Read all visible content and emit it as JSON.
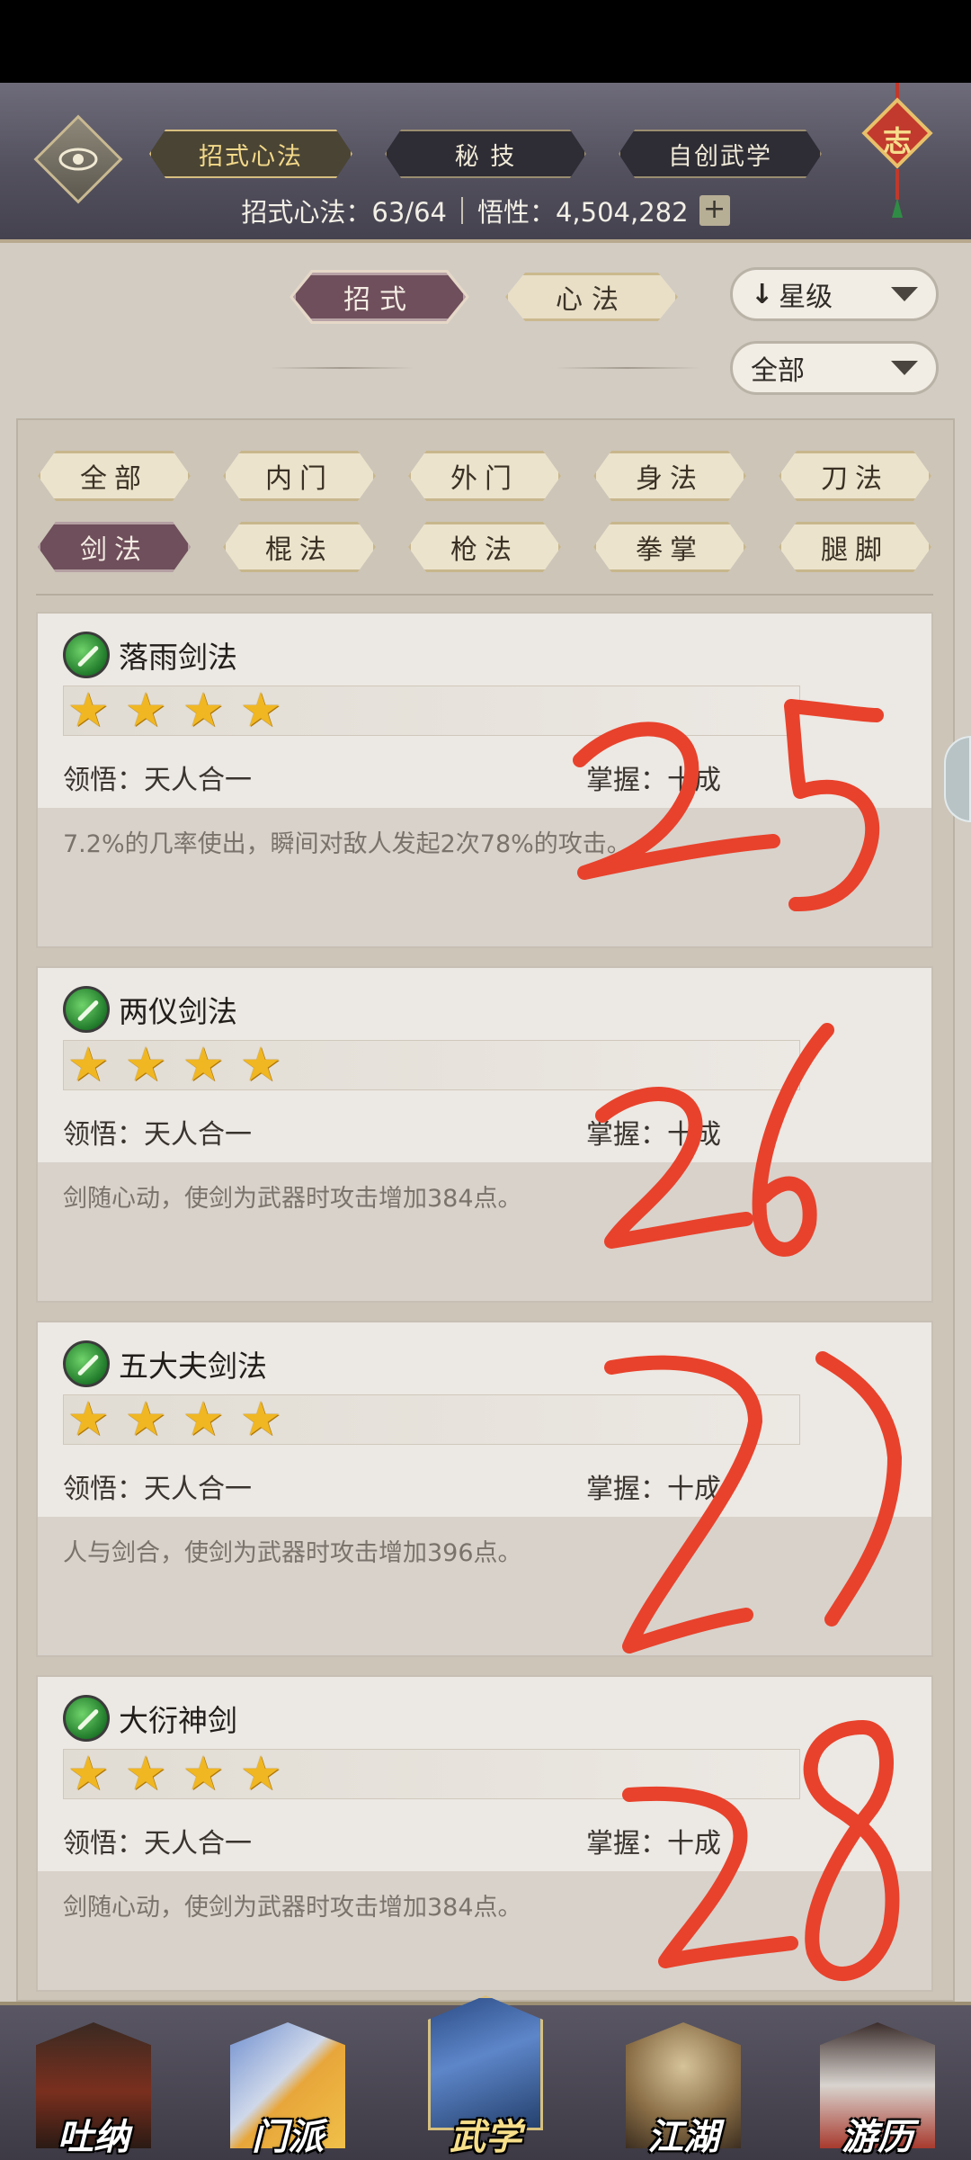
{
  "header": {
    "tabs": [
      {
        "label": "招式心法",
        "active": true
      },
      {
        "label": "秘 技",
        "active": false
      },
      {
        "label": "自创武学",
        "active": false
      }
    ],
    "stats": {
      "collection_label": "招式心法：63/64",
      "insight_label": "悟性：4,504,282",
      "plus_symbol": "+"
    },
    "charm_char": "志"
  },
  "subtabs": [
    {
      "label": "招式",
      "active": true
    },
    {
      "label": "心法",
      "active": false
    }
  ],
  "sort_dropdown": {
    "label": "星级",
    "arrow": "↓"
  },
  "filter_dropdown": {
    "label": "全部"
  },
  "categories": [
    {
      "label": "全部",
      "active": false
    },
    {
      "label": "内门",
      "active": false
    },
    {
      "label": "外门",
      "active": false
    },
    {
      "label": "身法",
      "active": false
    },
    {
      "label": "刀法",
      "active": false
    },
    {
      "label": "剑法",
      "active": true
    },
    {
      "label": "棍法",
      "active": false
    },
    {
      "label": "枪法",
      "active": false
    },
    {
      "label": "拳掌",
      "active": false
    },
    {
      "label": "腿脚",
      "active": false
    }
  ],
  "skills": [
    {
      "name": "落雨剑法",
      "stars": 4,
      "comprehension": "领悟：天人合一",
      "mastery": "掌握：十成",
      "description": "7.2%的几率使出，瞬间对敌人发起2次78%的攻击。"
    },
    {
      "name": "两仪剑法",
      "stars": 4,
      "comprehension": "领悟：天人合一",
      "mastery": "掌握：十成",
      "description": "剑随心动，使剑为武器时攻击增加384点。"
    },
    {
      "name": "五大夫剑法",
      "stars": 4,
      "comprehension": "领悟：天人合一",
      "mastery": "掌握：十成",
      "description": "人与剑合，使剑为武器时攻击增加396点。"
    },
    {
      "name": "大衍神剑",
      "stars": 4,
      "comprehension": "领悟：天人合一",
      "mastery": "掌握：十成",
      "description": "剑随心动，使剑为武器时攻击增加384点。"
    }
  ],
  "star_glyph": "★",
  "bottom_nav": [
    {
      "label": "吐纳",
      "active": false
    },
    {
      "label": "门派",
      "active": false
    },
    {
      "label": "武学",
      "active": true
    },
    {
      "label": "江湖",
      "active": false
    },
    {
      "label": "游历",
      "active": false
    }
  ],
  "annotations": [
    "25",
    "26",
    "27",
    "28"
  ],
  "colors": {
    "accent_purple": "#6e4f5b",
    "star_gold": "#f0b723",
    "annotation_red": "#e8422c"
  }
}
